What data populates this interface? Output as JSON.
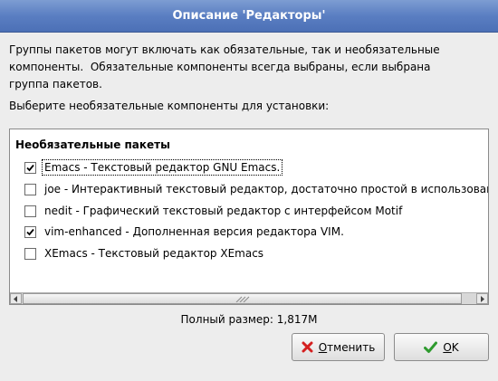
{
  "window": {
    "title": "Описание 'Редакторы'"
  },
  "description": {
    "line1": "Группы пакетов могут включать как обязательные, так и необязательные",
    "line2": "компоненты.  Обязательные компоненты всегда выбраны, если выбрана",
    "line3": "группа пакетов."
  },
  "prompt": "Выберите необязательные компоненты для установки:",
  "list": {
    "header": "Необязательные пакеты",
    "items": [
      {
        "label": "Emacs - Текстовый редактор GNU Emacs.",
        "checked": true
      },
      {
        "label": "joe - Интерактивный текстовый редактор, достаточно простой в использовани",
        "checked": false
      },
      {
        "label": "nedit - Графический текстовый редактор с интерфейсом Motif",
        "checked": false
      },
      {
        "label": "vim-enhanced - Дополненная версия редактора VIM.",
        "checked": true
      },
      {
        "label": "XEmacs - Текстовый редактор XEmacs",
        "checked": false
      }
    ]
  },
  "total_size": "Полный размер: 1,817M",
  "buttons": {
    "cancel_mnemonic": "О",
    "cancel_rest": "тменить",
    "ok_mnemonic": "O",
    "ok_rest": "K"
  },
  "icons": {
    "cancel": "red-x-icon",
    "ok": "green-check-icon"
  },
  "colors": {
    "titlebar": "#5a7ec2",
    "cancel_icon": "#d42020",
    "ok_icon": "#2e9a2e"
  }
}
